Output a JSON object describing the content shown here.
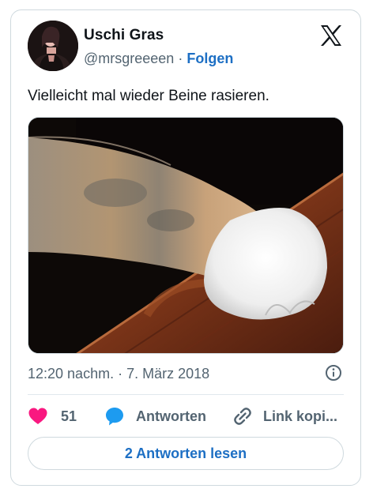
{
  "author": {
    "name": "Uschi Gras",
    "handle": "@mrsgreeeen",
    "separator": "·",
    "follow_label": "Folgen"
  },
  "tweet": {
    "text": "Vielleicht mal wieder Beine rasieren.",
    "time": "12:20 nachm.",
    "date_separator": "·",
    "date": "7. März 2018"
  },
  "actions": {
    "likes_count": "51",
    "reply_label": "Antworten",
    "copy_link_label": "Link kopi..."
  },
  "read_replies_label": "2 Antworten lesen",
  "colors": {
    "like": "#f91880",
    "reply": "#1d9bf0",
    "link": "#1d6fc4",
    "muted": "#536471"
  },
  "icons": {
    "logo": "x-logo-icon",
    "info": "info-icon",
    "like": "heart-icon",
    "reply": "speech-bubble-icon",
    "copy_link": "link-icon"
  }
}
